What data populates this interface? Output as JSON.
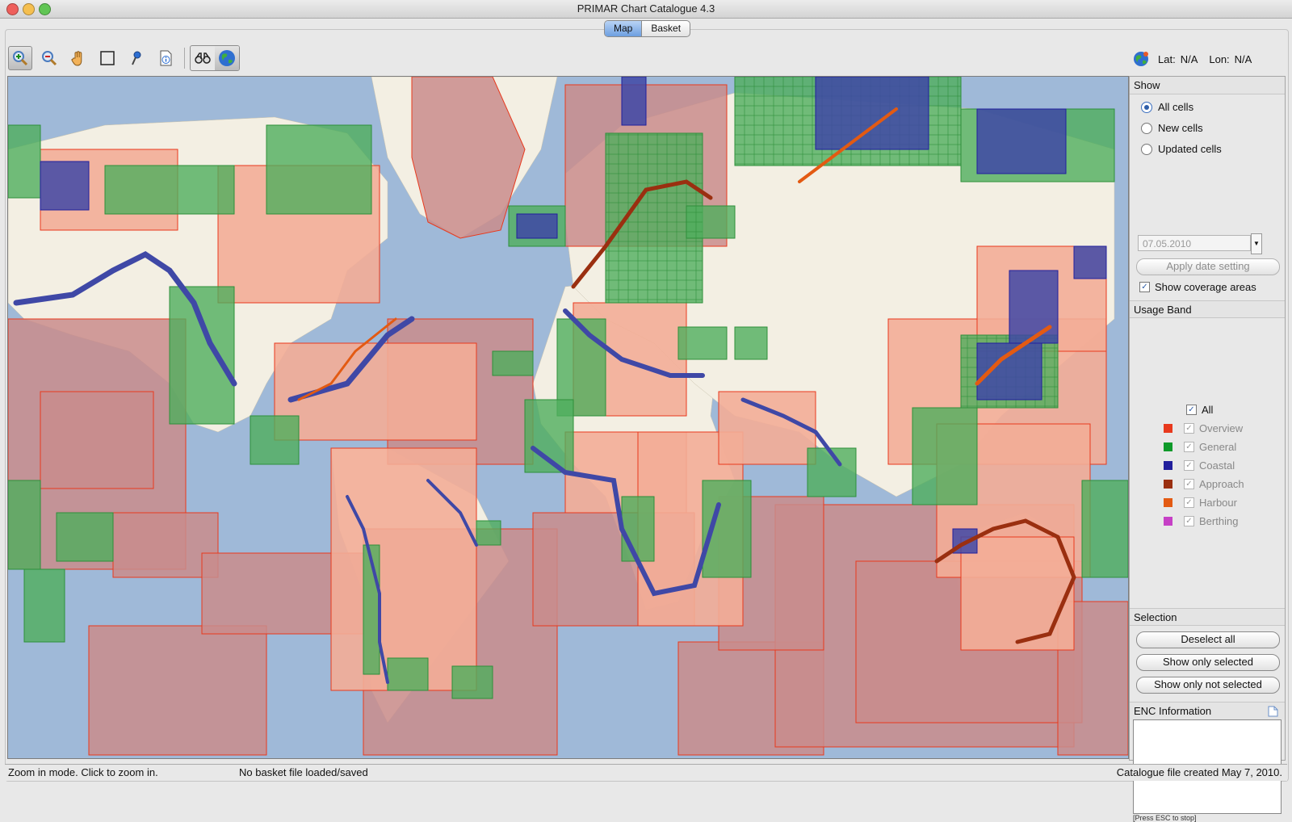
{
  "window": {
    "title": "PRIMAR Chart Catalogue 4.3"
  },
  "tabs": [
    {
      "label": "Map",
      "active": true
    },
    {
      "label": "Basket",
      "active": false
    }
  ],
  "toolbar": {
    "tools": [
      "zoom-in-icon",
      "zoom-out-icon",
      "pan-hand-icon",
      "select-rectangle-icon",
      "pin-icon",
      "info-icon"
    ],
    "views": [
      "binoculars-icon",
      "globe-icon"
    ]
  },
  "coords": {
    "lat_label": "Lat:",
    "lat_value": "N/A",
    "lon_label": "Lon:",
    "lon_value": "N/A"
  },
  "show": {
    "heading": "Show",
    "options": [
      {
        "label": "All cells",
        "selected": true
      },
      {
        "label": "New cells",
        "selected": false
      },
      {
        "label": "Updated cells",
        "selected": false
      }
    ],
    "date_value": "07.05.2010",
    "apply_label": "Apply date setting",
    "coverage_label": "Show coverage areas"
  },
  "usage_band": {
    "heading": "Usage Band",
    "all_label": "All",
    "bands": [
      {
        "label": "Overview",
        "color": "#e8391d"
      },
      {
        "label": "General",
        "color": "#0f9a2a"
      },
      {
        "label": "Coastal",
        "color": "#211f9c"
      },
      {
        "label": "Approach",
        "color": "#9a2f10"
      },
      {
        "label": "Harbour",
        "color": "#e35a12"
      },
      {
        "label": "Berthing",
        "color": "#c640c6"
      }
    ]
  },
  "selection": {
    "heading": "Selection",
    "deselect_label": "Deselect all",
    "show_selected_label": "Show only selected",
    "show_not_selected_label": "Show only not selected"
  },
  "enc": {
    "heading": "ENC Information",
    "esc_hint": "[Press ESC to stop]"
  },
  "status": {
    "mode": "Zoom in mode. Click to zoom in.",
    "basket": "No basket file loaded/saved",
    "catalogue": "Catalogue file created May 7, 2010."
  },
  "map_colors": {
    "ocean": "#9fb9d8",
    "land": "#f3efe3",
    "overview": "#c98c8c",
    "overview_light": "#f3ad97",
    "general": "#4fae5c",
    "coastal": "#3f48a6",
    "harbour": "#e35a12"
  }
}
